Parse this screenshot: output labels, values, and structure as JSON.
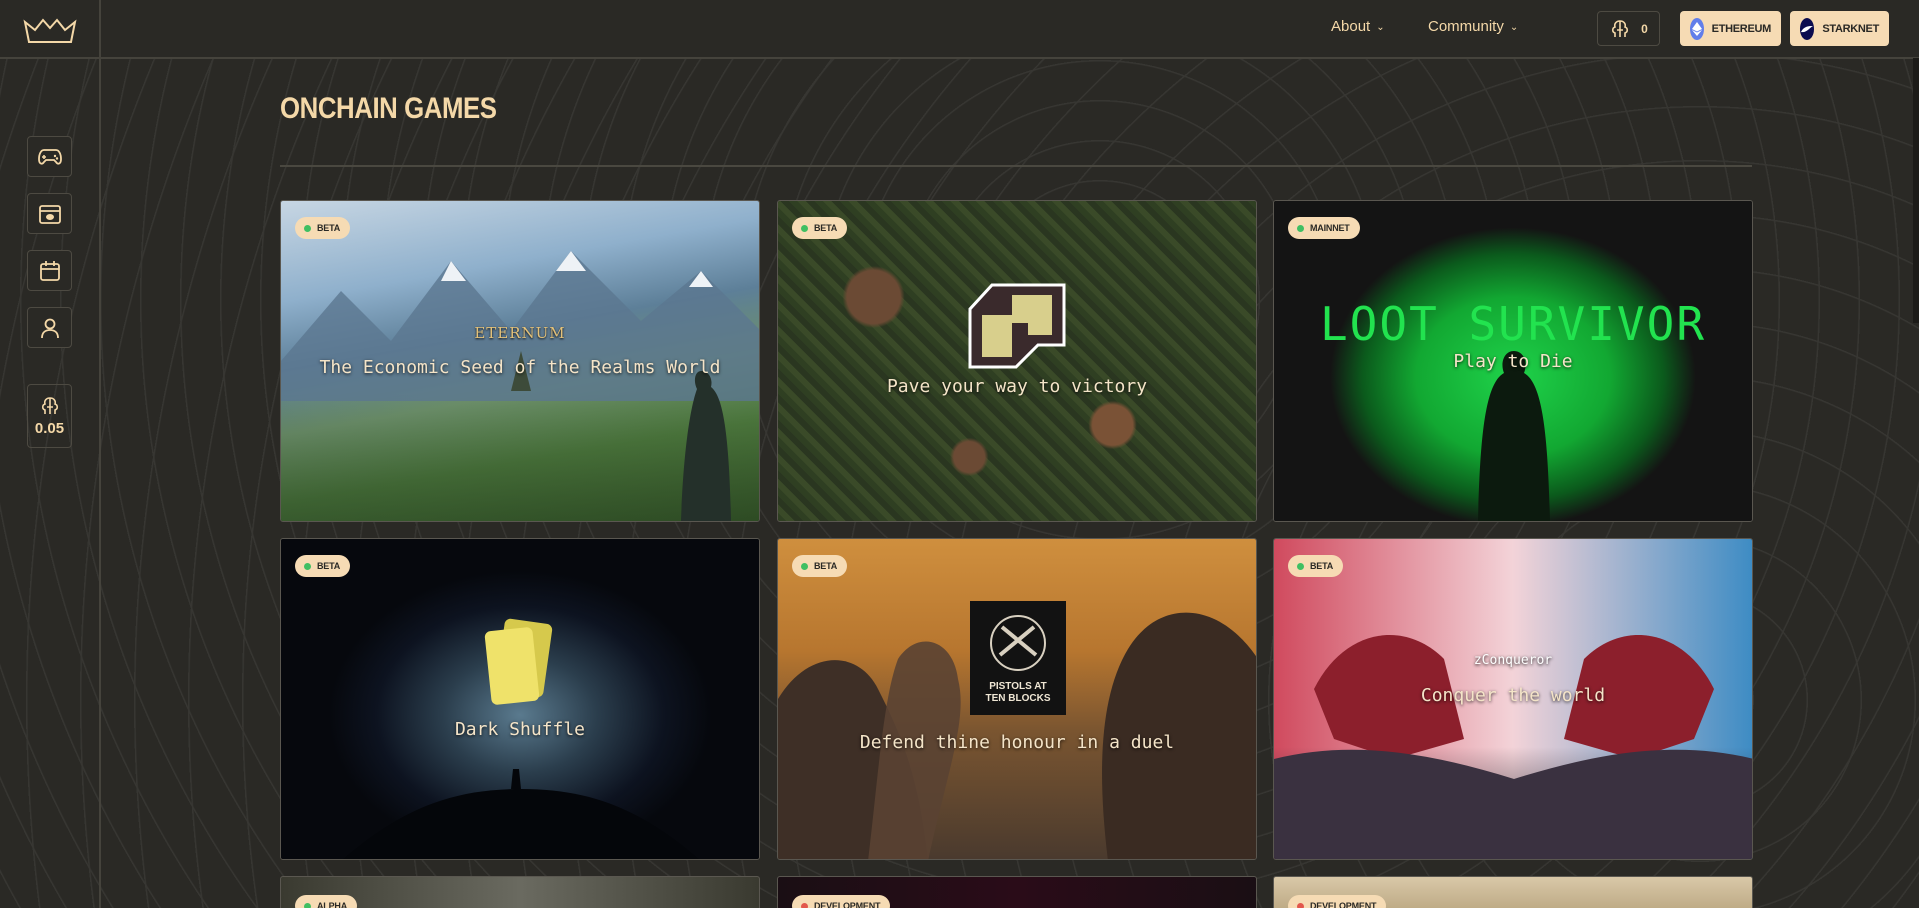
{
  "header": {
    "nav": [
      {
        "label": "About"
      },
      {
        "label": "Community"
      }
    ],
    "lords_balance": "0",
    "wallets": [
      {
        "label": "ETHEREUM",
        "color": "#627eea"
      },
      {
        "label": "STARKNET",
        "color": "#0c0c4f"
      }
    ]
  },
  "sidebar": {
    "items": [
      {
        "icon": "gamepad-icon"
      },
      {
        "icon": "chest-icon"
      },
      {
        "icon": "calendar-icon"
      },
      {
        "icon": "user-icon"
      }
    ],
    "lords_price": "0.05"
  },
  "main": {
    "title": "ONCHAIN GAMES",
    "games": [
      {
        "badge": "BETA",
        "logo": "ETERNUM",
        "tagline": "The Economic Seed of the Realms World"
      },
      {
        "badge": "BETA",
        "tagline": "Pave your way to victory"
      },
      {
        "badge": "MAINNET",
        "logo": "LOOT SURVIVOR",
        "tagline": "Play to Die"
      },
      {
        "badge": "BETA",
        "tagline": "Dark Shuffle"
      },
      {
        "badge": "BETA",
        "logo": "PISTOLS AT TEN BLOCKS",
        "tagline": "Defend thine honour in a duel"
      },
      {
        "badge": "BETA",
        "logo": "zConqueror",
        "tagline": "Conquer the world"
      },
      {
        "badge": "ALPHA"
      },
      {
        "badge": "DEVELOPMENT"
      },
      {
        "badge": "DEVELOPMENT"
      }
    ]
  },
  "colors": {
    "background": "#2a2925",
    "accent": "#f4d8a8",
    "badge_bg": "#f6dbb4",
    "dot_green": "#3fbf62",
    "dot_red": "#e2574c"
  }
}
